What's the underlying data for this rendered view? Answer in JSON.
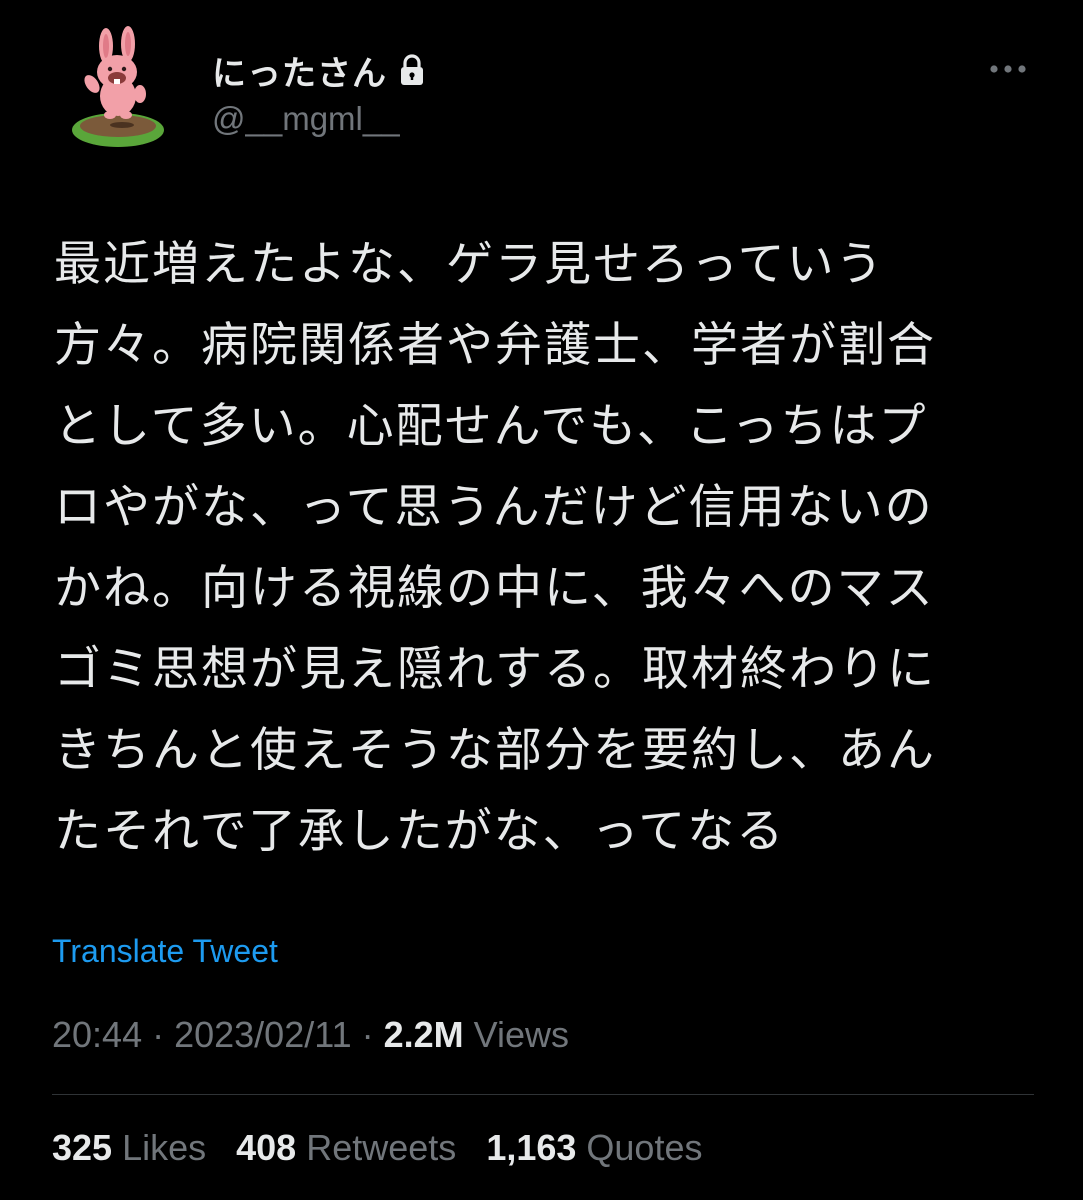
{
  "user": {
    "display_name": "にったさん",
    "handle": "@__mgml__",
    "avatar_icon": "rabbit-avatar-icon",
    "lock_icon": "lock-icon"
  },
  "header": {
    "more_icon": "more-dots-icon"
  },
  "tweet": {
    "lines": [
      "最近増えたよな、ゲラ見せろっていう",
      "方々。病院関係者や弁護士、学者が割合",
      "として多い。心配せんでも、こっちはプ",
      "ロやがな、って思うんだけど信用ないの",
      "かね。向ける視線の中に、我々へのマス",
      "ゴミ思想が見え隠れする。取材終わりに",
      "きちんと使えそうな部分を要約し、あん",
      "たそれで了承したがな、ってなる"
    ],
    "translate_label": "Translate Tweet"
  },
  "meta": {
    "time": "20:44",
    "separator": " · ",
    "date": "2023/02/11",
    "views_count": "2.2M",
    "views_label": " Views"
  },
  "stats": {
    "likes_count": "325",
    "likes_label": " Likes",
    "retweets_count": "408",
    "retweets_label": " Retweets",
    "quotes_count": "1,163",
    "quotes_label": " Quotes"
  },
  "colors": {
    "background": "#000000",
    "primary_text": "#e7e9ea",
    "secondary_text": "#71767b",
    "link": "#1d9bf0",
    "divider": "#2f3336"
  }
}
